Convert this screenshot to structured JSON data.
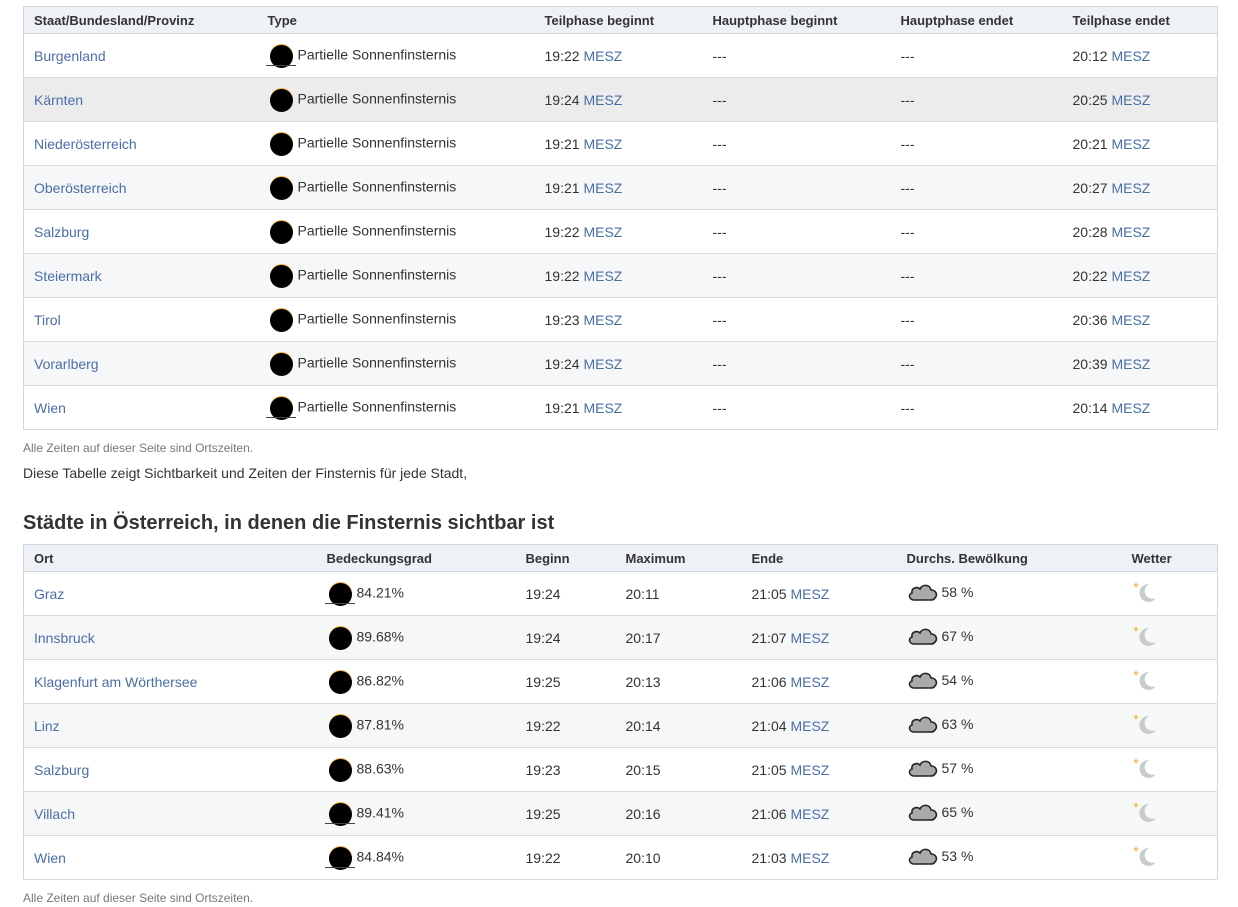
{
  "table1": {
    "headers": [
      "Staat/Bundesland/Provinz",
      "Type",
      "Teilphase beginnt",
      "Hauptphase beginnt",
      "Hauptphase endet",
      "Teilphase endet"
    ],
    "rows": [
      {
        "region": "Burgenland",
        "type": "Partielle Sonnenfinsternis",
        "teil_start": "19:22",
        "haupt_start": "---",
        "haupt_end": "---",
        "teil_end": "20:12",
        "tz": "MESZ"
      },
      {
        "region": "Kärnten",
        "type": "Partielle Sonnenfinsternis",
        "teil_start": "19:24",
        "haupt_start": "---",
        "haupt_end": "---",
        "teil_end": "20:25",
        "tz": "MESZ"
      },
      {
        "region": "Niederösterreich",
        "type": "Partielle Sonnenfinsternis",
        "teil_start": "19:21",
        "haupt_start": "---",
        "haupt_end": "---",
        "teil_end": "20:21",
        "tz": "MESZ"
      },
      {
        "region": "Oberösterreich",
        "type": "Partielle Sonnenfinsternis",
        "teil_start": "19:21",
        "haupt_start": "---",
        "haupt_end": "---",
        "teil_end": "20:27",
        "tz": "MESZ"
      },
      {
        "region": "Salzburg",
        "type": "Partielle Sonnenfinsternis",
        "teil_start": "19:22",
        "haupt_start": "---",
        "haupt_end": "---",
        "teil_end": "20:28",
        "tz": "MESZ"
      },
      {
        "region": "Steiermark",
        "type": "Partielle Sonnenfinsternis",
        "teil_start": "19:22",
        "haupt_start": "---",
        "haupt_end": "---",
        "teil_end": "20:22",
        "tz": "MESZ"
      },
      {
        "region": "Tirol",
        "type": "Partielle Sonnenfinsternis",
        "teil_start": "19:23",
        "haupt_start": "---",
        "haupt_end": "---",
        "teil_end": "20:36",
        "tz": "MESZ"
      },
      {
        "region": "Vorarlberg",
        "type": "Partielle Sonnenfinsternis",
        "teil_start": "19:24",
        "haupt_start": "---",
        "haupt_end": "---",
        "teil_end": "20:39",
        "tz": "MESZ"
      },
      {
        "region": "Wien",
        "type": "Partielle Sonnenfinsternis",
        "teil_start": "19:21",
        "haupt_start": "---",
        "haupt_end": "---",
        "teil_end": "20:14",
        "tz": "MESZ"
      }
    ],
    "note": "Alle Zeiten auf dieser Seite sind Ortszeiten."
  },
  "paragraph": "Diese Tabelle zeigt Sichtbarkeit und Zeiten der Finsternis für jede Stadt,",
  "section2": {
    "title": "Städte in Österreich, in denen die Finsternis sichtbar ist",
    "headers": [
      "Ort",
      "Bedeckungsgrad",
      "Beginn",
      "Maximum",
      "Ende",
      "Durchs. Bewölkung",
      "Wetter"
    ],
    "rows": [
      {
        "city": "Graz",
        "coverage": "84.21%",
        "begin": "19:24",
        "max": "20:11",
        "end": "21:05",
        "tz": "MESZ",
        "cloud": "58 %",
        "weather_icon": "clear-night-icon"
      },
      {
        "city": "Innsbruck",
        "coverage": "89.68%",
        "begin": "19:24",
        "max": "20:17",
        "end": "21:07",
        "tz": "MESZ",
        "cloud": "67 %",
        "weather_icon": "clear-night-icon"
      },
      {
        "city": "Klagenfurt am Wörthersee",
        "coverage": "86.82%",
        "begin": "19:25",
        "max": "20:13",
        "end": "21:06",
        "tz": "MESZ",
        "cloud": "54 %",
        "weather_icon": "clear-night-icon"
      },
      {
        "city": "Linz",
        "coverage": "87.81%",
        "begin": "19:22",
        "max": "20:14",
        "end": "21:04",
        "tz": "MESZ",
        "cloud": "63 %",
        "weather_icon": "clear-night-icon"
      },
      {
        "city": "Salzburg",
        "coverage": "88.63%",
        "begin": "19:23",
        "max": "20:15",
        "end": "21:05",
        "tz": "MESZ",
        "cloud": "57 %",
        "weather_icon": "clear-night-icon"
      },
      {
        "city": "Villach",
        "coverage": "89.41%",
        "begin": "19:25",
        "max": "20:16",
        "end": "21:06",
        "tz": "MESZ",
        "cloud": "65 %",
        "weather_icon": "clear-night-icon"
      },
      {
        "city": "Wien",
        "coverage": "84.84%",
        "begin": "19:22",
        "max": "20:10",
        "end": "21:03",
        "tz": "MESZ",
        "cloud": "53 %",
        "weather_icon": "clear-night-icon"
      }
    ],
    "note": "Alle Zeiten auf dieser Seite sind Ortszeiten."
  },
  "colors": {
    "link": "#4a6ea8",
    "sun": "#f2b233",
    "header_bg": "#eef1f5"
  }
}
